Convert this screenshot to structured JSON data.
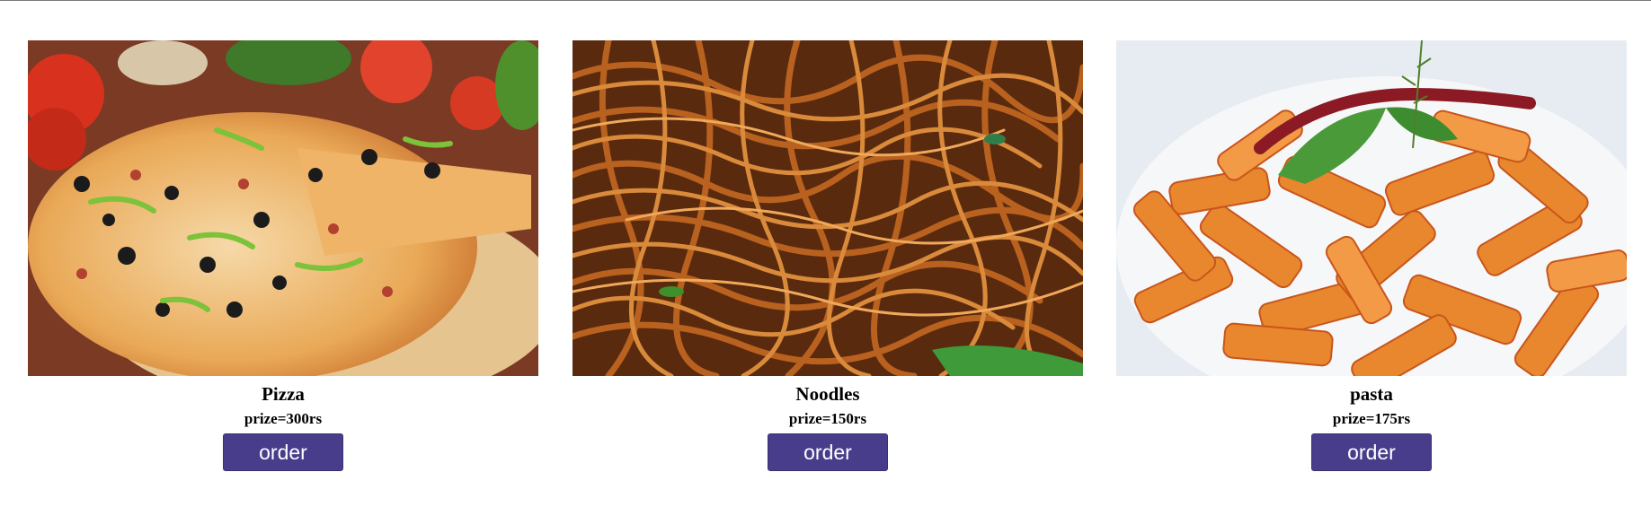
{
  "menu": {
    "items": [
      {
        "name": "Pizza",
        "price": "prize=300rs",
        "order_label": "order",
        "image": "pizza-photo"
      },
      {
        "name": "Noodles",
        "price": "prize=150rs",
        "order_label": "order",
        "image": "noodles-photo"
      },
      {
        "name": "pasta",
        "price": "prize=175rs",
        "order_label": "order",
        "image": "pasta-photo"
      }
    ]
  },
  "colors": {
    "button_bg": "#483d8b",
    "button_text": "#ffffff"
  }
}
